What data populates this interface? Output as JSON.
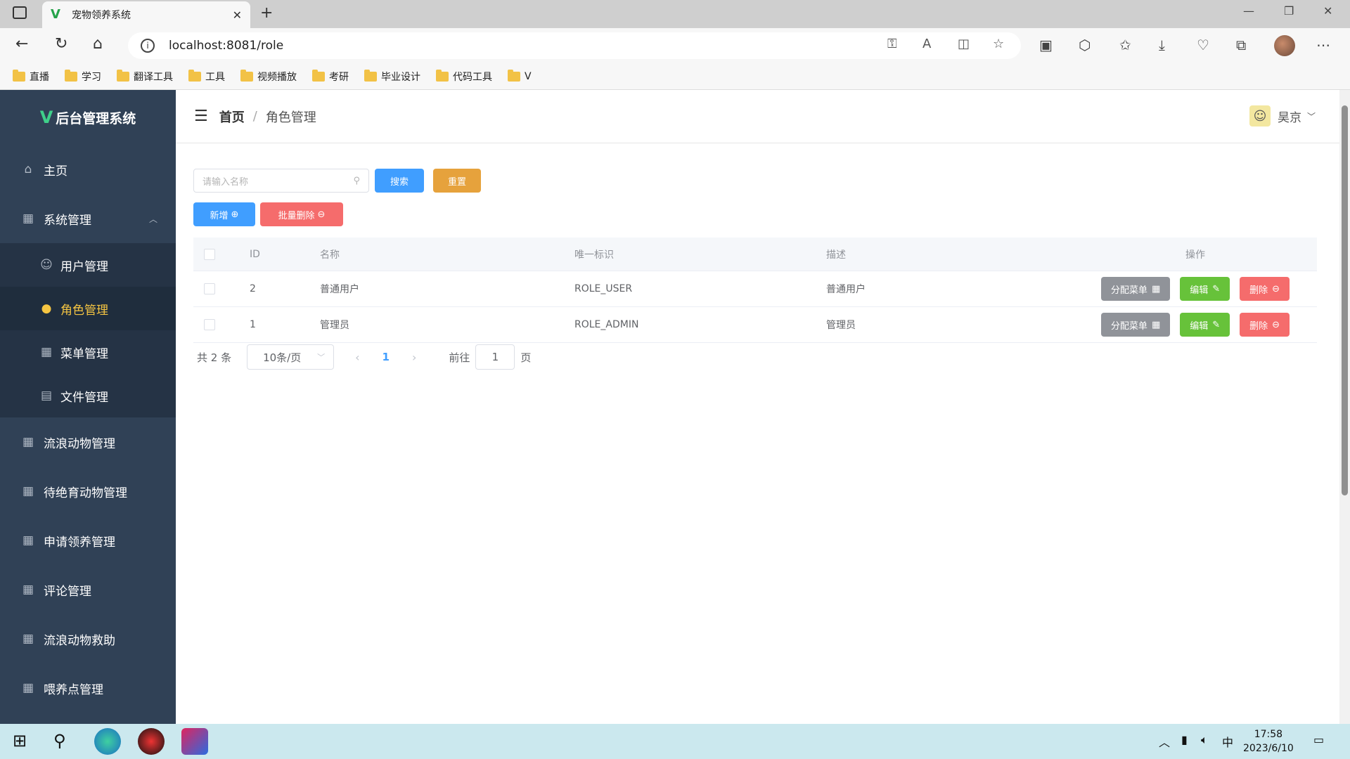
{
  "browser": {
    "tab_title": "宠物领养系统",
    "url": "localhost:8081/role",
    "bookmarks": [
      "直播",
      "学习",
      "翻译工具",
      "工具",
      "视频播放",
      "考研",
      "毕业设计",
      "代码工具",
      "V"
    ]
  },
  "app": {
    "logo_text": "后台管理系统",
    "logo_mark": "V"
  },
  "sidebar": {
    "items": [
      {
        "label": "主页",
        "icon": "home-icon"
      },
      {
        "label": "系统管理",
        "icon": "grid-icon",
        "expanded": true
      },
      {
        "label": "用户管理",
        "icon": "user-icon",
        "sub": true
      },
      {
        "label": "角色管理",
        "icon": "user-filled-icon",
        "sub": true,
        "active": true
      },
      {
        "label": "菜单管理",
        "icon": "menu-icon",
        "sub": true
      },
      {
        "label": "文件管理",
        "icon": "document-icon",
        "sub": true
      },
      {
        "label": "流浪动物管理",
        "icon": "grid-icon"
      },
      {
        "label": "待绝育动物管理",
        "icon": "grid-icon"
      },
      {
        "label": "申请领养管理",
        "icon": "grid-icon"
      },
      {
        "label": "评论管理",
        "icon": "grid-icon"
      },
      {
        "label": "流浪动物救助",
        "icon": "grid-icon"
      },
      {
        "label": "喂养点管理",
        "icon": "grid-icon"
      }
    ]
  },
  "header": {
    "breadcrumb_home": "首页",
    "breadcrumb_sep": "/",
    "breadcrumb_current": "角色管理",
    "username": "昊京"
  },
  "toolbar": {
    "search_placeholder": "请输入名称",
    "search_label": "搜索",
    "reset_label": "重置",
    "add_label": "新增",
    "batch_delete_label": "批量删除"
  },
  "table": {
    "headers": [
      "ID",
      "名称",
      "唯一标识",
      "描述",
      "操作"
    ],
    "rows": [
      {
        "id": "2",
        "name": "普通用户",
        "flag": "ROLE_USER",
        "desc": "普通用户"
      },
      {
        "id": "1",
        "name": "管理员",
        "flag": "ROLE_ADMIN",
        "desc": "管理员"
      }
    ],
    "assign_label": "分配菜单",
    "edit_label": "编辑",
    "delete_label": "删除"
  },
  "pagination": {
    "total": "共 2 条",
    "page_size": "10条/页",
    "current_page": "1",
    "goto_label": "前往",
    "goto_value": "1",
    "page_suffix": "页"
  },
  "taskbar": {
    "time": "17:58",
    "date": "2023/6/10",
    "ime": "中"
  },
  "colors": {
    "sidebar_bg": "#304156",
    "active_text": "#f5c542",
    "primary": "#409eff",
    "warning": "#e6a23c",
    "danger": "#f56c6c",
    "success": "#67c23a",
    "info": "#909399"
  }
}
